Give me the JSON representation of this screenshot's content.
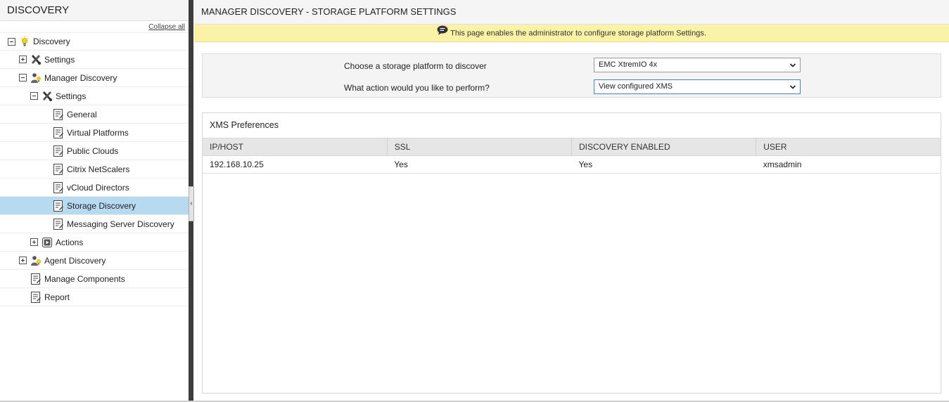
{
  "sidebar": {
    "title": "DISCOVERY",
    "collapse_all": "Collapse all",
    "items": [
      {
        "label": "Discovery"
      },
      {
        "label": "Settings"
      },
      {
        "label": "Manager Discovery"
      },
      {
        "label": "Settings"
      },
      {
        "label": "General"
      },
      {
        "label": "Virtual Platforms"
      },
      {
        "label": "Public Clouds"
      },
      {
        "label": "Citrix NetScalers"
      },
      {
        "label": "vCloud Directors"
      },
      {
        "label": "Storage Discovery"
      },
      {
        "label": "Messaging Server Discovery"
      },
      {
        "label": "Actions"
      },
      {
        "label": "Agent Discovery"
      },
      {
        "label": "Manage Components"
      },
      {
        "label": "Report"
      }
    ],
    "collapse_handle": "‹"
  },
  "main": {
    "title": "MANAGER DISCOVERY - STORAGE PLATFORM SETTINGS",
    "info": "This page enables the administrator to configure storage platform Settings.",
    "form": {
      "platform_label": "Choose a storage platform to discover",
      "platform_value": "EMC XtremIO 4x",
      "action_label": "What action would you like to perform?",
      "action_value": "View configured XMS"
    },
    "xms": {
      "title": "XMS Preferences",
      "columns": [
        "IP/HOST",
        "SSL",
        "DISCOVERY ENABLED",
        "USER"
      ],
      "rows": [
        [
          "192.168.10.25",
          "Yes",
          "Yes",
          "xmsadmin"
        ]
      ]
    }
  },
  "colors": {
    "selected_row": "#b6daf0",
    "info_bar": "#faf2a6",
    "splitter": "#3c3c3c"
  }
}
